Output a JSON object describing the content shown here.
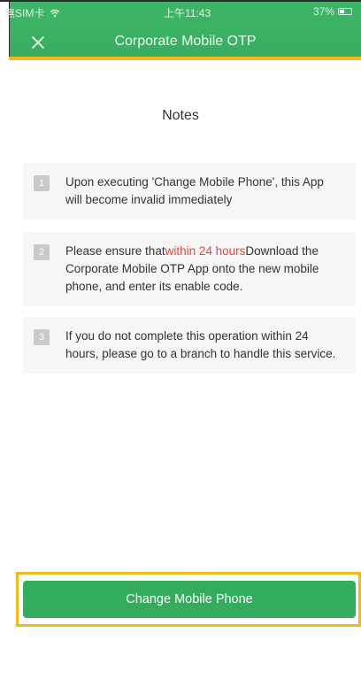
{
  "status_bar": {
    "carrier": "無SIM卡",
    "time": "上午11:43",
    "battery": "37%"
  },
  "header": {
    "title": "Corporate Mobile OTP",
    "close_icon": "close-icon"
  },
  "notes": {
    "title": "Notes",
    "items": [
      {
        "number": "1",
        "text": "Upon executing 'Change Mobile Phone', this App will become invalid immediately"
      },
      {
        "number": "2",
        "prefix": "Please ensure that",
        "highlight": "within 24 hours",
        "suffix": "Download the Corporate Mobile OTP App onto the new mobile phone, and enter its enable code."
      },
      {
        "number": "3",
        "text": "If you do not complete this operation within 24 hours, please go to a branch to handle this service."
      }
    ]
  },
  "actions": {
    "change_label": "Change Mobile Phone"
  },
  "colors": {
    "brand_green": "#36ad60",
    "highlight_red": "#e8453c",
    "focus_yellow": "#f3b81d"
  }
}
